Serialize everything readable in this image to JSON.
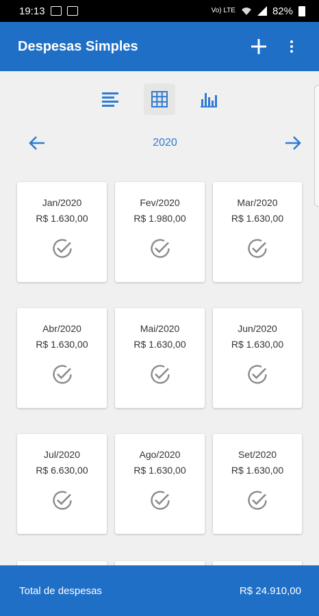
{
  "status_bar": {
    "time": "19:13",
    "network": "Vo) LTE",
    "battery": "82%"
  },
  "app_bar": {
    "title": "Despesas Simples",
    "add_icon": "plus-icon",
    "menu_icon": "more-vert-icon"
  },
  "view_toggle": {
    "options": [
      "list-icon",
      "grid-icon",
      "bar-chart-icon"
    ],
    "selected": "grid-icon"
  },
  "year_nav": {
    "year": "2020",
    "prev_icon": "arrow-left-icon",
    "next_icon": "arrow-right-icon"
  },
  "months": [
    {
      "month": "Jan/2020",
      "value": "R$ 1.630,00",
      "status": "paid"
    },
    {
      "month": "Fev/2020",
      "value": "R$ 1.980,00",
      "status": "paid"
    },
    {
      "month": "Mar/2020",
      "value": "R$ 1.630,00",
      "status": "paid"
    },
    {
      "month": "Abr/2020",
      "value": "R$ 1.630,00",
      "status": "paid"
    },
    {
      "month": "Mai/2020",
      "value": "R$ 1.630,00",
      "status": "paid"
    },
    {
      "month": "Jun/2020",
      "value": "R$ 1.630,00",
      "status": "paid"
    },
    {
      "month": "Jul/2020",
      "value": "R$ 6.630,00",
      "status": "paid"
    },
    {
      "month": "Ago/2020",
      "value": "R$ 1.630,00",
      "status": "paid"
    },
    {
      "month": "Set/2020",
      "value": "R$ 1.630,00",
      "status": "paid"
    }
  ],
  "footer": {
    "label": "Total de despesas",
    "total": "R$ 24.910,00"
  },
  "colors": {
    "primary": "#1f6fc6",
    "accent": "#2d7ad3",
    "check": "#8a8a8a"
  }
}
